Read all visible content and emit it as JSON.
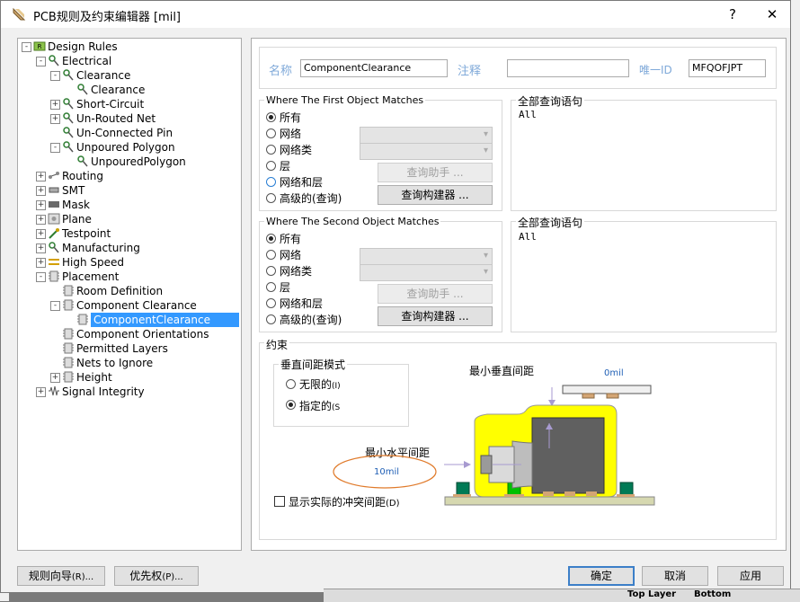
{
  "window": {
    "title": "PCB规则及约束编辑器 [mil]",
    "help_label": "?",
    "close_label": "✕"
  },
  "background": {
    "taskbar_layers": [
      "Top Layer",
      "Bottom"
    ]
  },
  "tree": {
    "root": "Design Rules",
    "electrical": "Electrical",
    "clearance": "Clearance",
    "clearance_child": "Clearance",
    "short_circuit": "Short-Circuit",
    "unrouted_net": "Un-Routed Net",
    "unconnected_pin": "Un-Connected Pin",
    "unpoured_polygon": "Unpoured Polygon",
    "unpoured_polygon_child": "UnpouredPolygon",
    "routing": "Routing",
    "smt": "SMT",
    "mask": "Mask",
    "plane": "Plane",
    "testpoint": "Testpoint",
    "manufacturing": "Manufacturing",
    "high_speed": "High Speed",
    "placement": "Placement",
    "room_definition": "Room Definition",
    "component_clearance": "Component Clearance",
    "component_clearance_child": "ComponentClearance",
    "component_orientations": "Component Orientations",
    "permitted_layers": "Permitted Layers",
    "nets_to_ignore": "Nets to Ignore",
    "height": "Height",
    "signal_integrity": "Signal Integrity"
  },
  "rule": {
    "name_label": "名称",
    "name_value": "ComponentClearance",
    "comment_label": "注释",
    "comment_value": "",
    "uid_label": "唯一ID",
    "uid_value": "MFQOFJPT"
  },
  "first_match": {
    "title": "Where The First Object Matches",
    "options": [
      "所有",
      "网络",
      "网络类",
      "层",
      "网络和层",
      "高级的(查询)"
    ],
    "selected": "所有",
    "query_helper": "查询助手 ...",
    "query_builder": "查询构建器 ...",
    "full_query_title": "全部查询语句",
    "full_query": "All"
  },
  "second_match": {
    "title": "Where The Second Object Matches",
    "options": [
      "所有",
      "网络",
      "网络类",
      "层",
      "网络和层",
      "高级的(查询)"
    ],
    "selected": "所有",
    "query_helper": "查询助手 ...",
    "query_builder": "查询构建器 ...",
    "full_query_title": "全部查询语句",
    "full_query": "All"
  },
  "constraint": {
    "title": "约束",
    "vertical_mode_title": "垂直间距模式",
    "infinite_label": "无限的",
    "infinite_key": "(I)",
    "specified_label": "指定的",
    "specified_key": "(S",
    "vertical_mode_selected": "指定的",
    "min_vertical_label": "最小垂直间距",
    "min_vertical_value": "0mil",
    "min_horizontal_label": "最小水平间距",
    "min_horizontal_value": "10mil",
    "show_actual_label": "显示实际的冲突间距",
    "show_actual_key": "(D)",
    "show_actual_checked": false
  },
  "footer": {
    "wizard": "规则向导",
    "wizard_key": "(R)...",
    "priority": "优先权",
    "priority_key": "(P)...",
    "ok": "确定",
    "cancel": "取消",
    "apply": "应用"
  },
  "colors": {
    "selection": "#3399ff",
    "keepout": "#ffff00",
    "component_body": "#606060",
    "pad_green": "#007a55",
    "pad_bright": "#00c000",
    "board": "#d6d8b0"
  }
}
